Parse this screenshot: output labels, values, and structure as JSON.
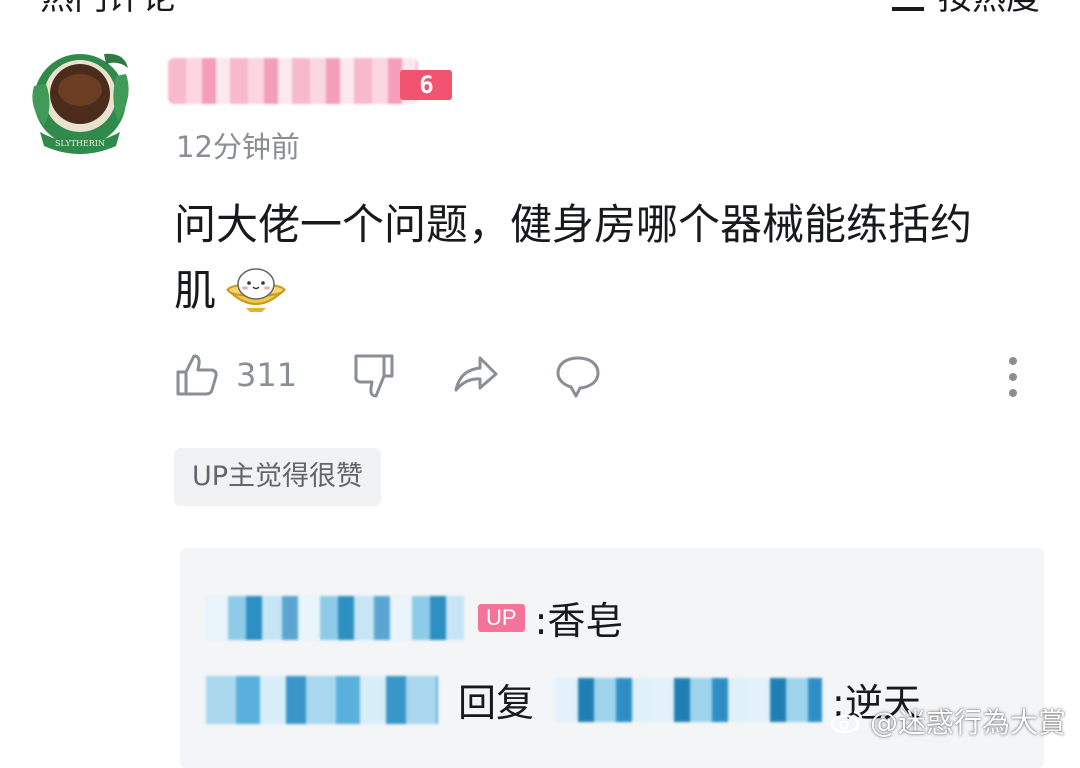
{
  "header": {
    "title": "热门评论",
    "sort_label": "按热度"
  },
  "comment": {
    "level": "6",
    "time": "12分钟前",
    "text_line1": "问大佬一个问题，健身房哪个器械能练括约",
    "text_line2": "肌",
    "emoji_icon": "rice-bowl-face-emoji",
    "likes": "311",
    "up_badge": "UP主觉得很赞"
  },
  "replies": [
    {
      "tag": "UP",
      "text": ":香皂"
    },
    {
      "reply_word": "回复",
      "text": ":逆天"
    }
  ],
  "watermark": {
    "text": "@迷惑行為大賞"
  },
  "colors": {
    "level_badge": "#f2536f",
    "up_tag": "#f37498",
    "muted": "#8a8e95",
    "reply_bg": "#f4f5f7"
  }
}
